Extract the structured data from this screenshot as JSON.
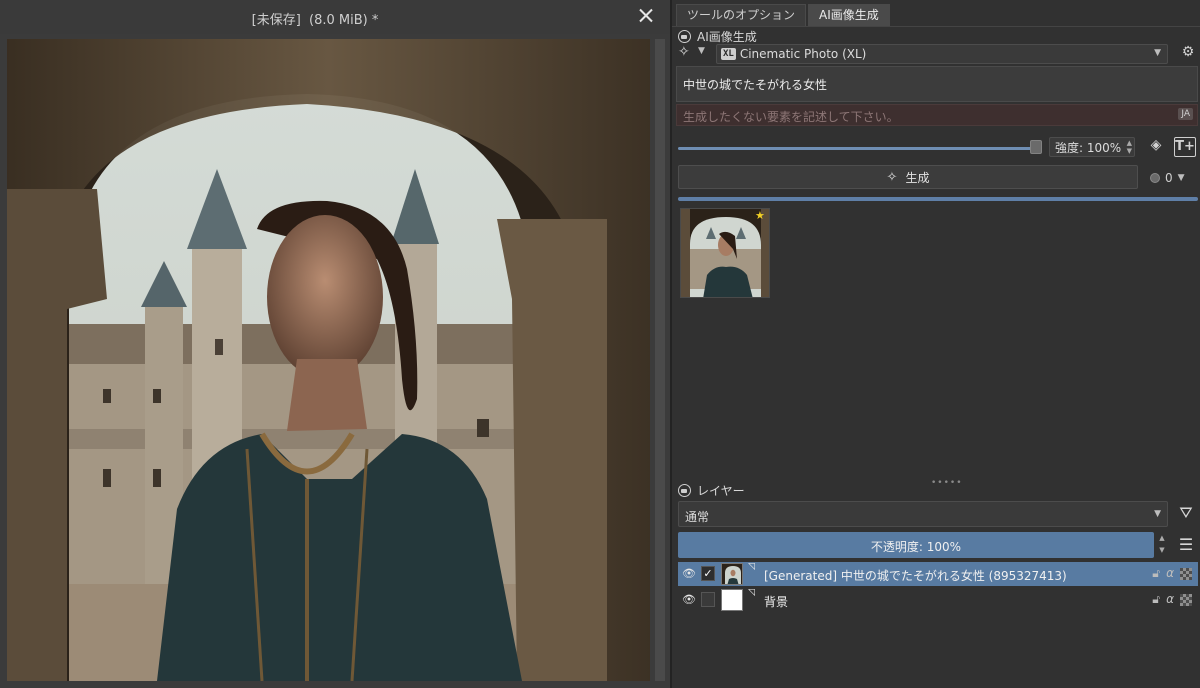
{
  "document": {
    "title": "[未保存]  (8.0 MiB) *"
  },
  "dock": {
    "tabs": [
      {
        "label": "ツールのオプション"
      },
      {
        "label": "AI画像生成"
      }
    ],
    "ai_panel": {
      "header": "AI画像生成",
      "model": "Cinematic Photo (XL)",
      "model_badge": "XL",
      "prompt": "中世の城でたそがれる女性",
      "negative_placeholder": "生成したくない要素を記述して下さい。",
      "language_badge": "JA",
      "strength_label": "強度: 100%",
      "strength_value": 1.0,
      "generate_label": "生成",
      "queue_count": "0"
    },
    "layers_panel": {
      "header": "レイヤー",
      "blend_mode": "通常",
      "opacity_label": "不透明度:  100%",
      "opacity_value": 1.0,
      "layers": [
        {
          "name": "[Generated] 中世の城でたそがれる女性 (895327413)",
          "visible": true,
          "selected": true
        },
        {
          "name": "背景",
          "visible": true,
          "selected": false
        }
      ]
    }
  },
  "icons": {
    "close": "close-icon",
    "wand": "magic-wand-icon",
    "settings": "gears-icon",
    "layers_add": "add-layer-icon",
    "text_add": "add-text-icon",
    "filter": "filter-icon",
    "menu": "hamburger-menu-icon",
    "eye": "eye-icon",
    "star": "star-icon"
  },
  "colors": {
    "accent": "#587ba2",
    "highlight": "#e01515",
    "star": "#f2d025"
  }
}
